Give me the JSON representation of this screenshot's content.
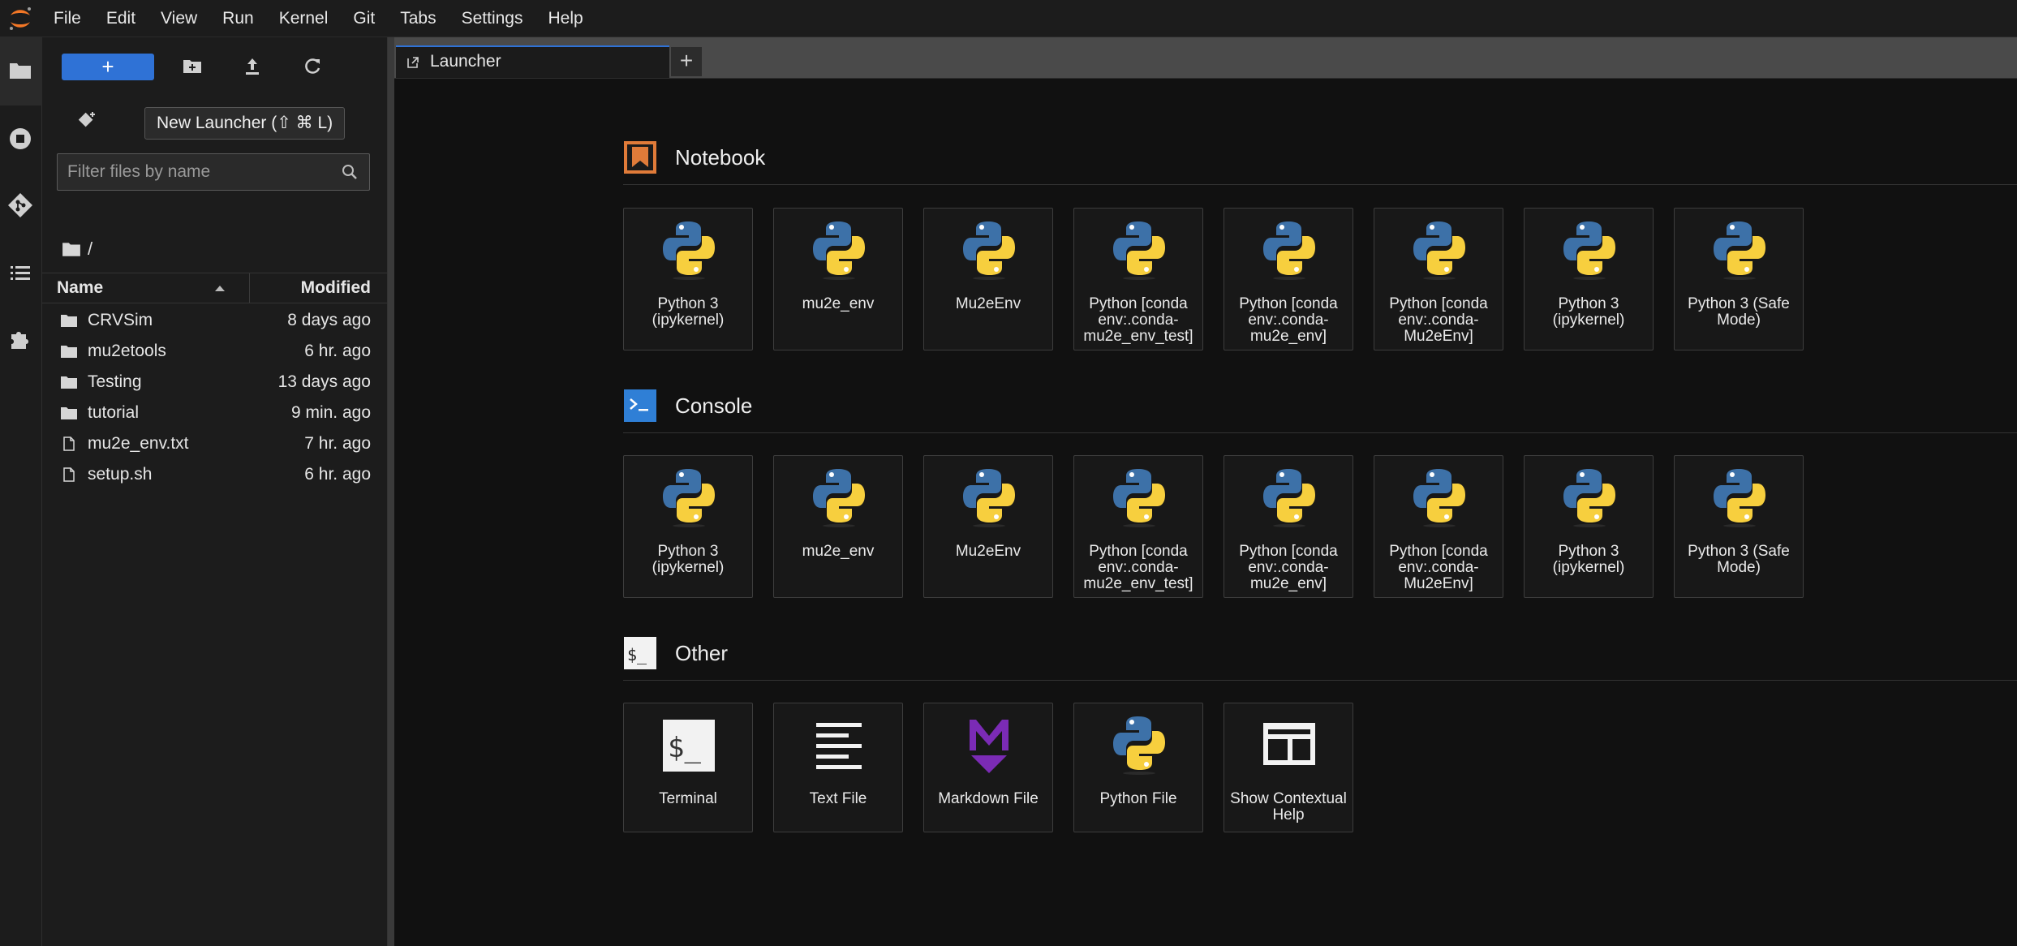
{
  "menubar": {
    "items": [
      "File",
      "Edit",
      "View",
      "Run",
      "Kernel",
      "Git",
      "Tabs",
      "Settings",
      "Help"
    ]
  },
  "filebrowser": {
    "new_launcher_label": "+",
    "tooltip": "New Launcher (⇧ ⌘ L)",
    "filter_placeholder": "Filter files by name",
    "breadcrumb": "/",
    "columns": {
      "name": "Name",
      "modified": "Modified"
    },
    "files": [
      {
        "name": "CRVSim",
        "modified": "8 days ago",
        "type": "folder"
      },
      {
        "name": "mu2etools",
        "modified": "6 hr. ago",
        "type": "folder"
      },
      {
        "name": "Testing",
        "modified": "13 days ago",
        "type": "folder"
      },
      {
        "name": "tutorial",
        "modified": "9 min. ago",
        "type": "folder"
      },
      {
        "name": "mu2e_env.txt",
        "modified": "7 hr. ago",
        "type": "file"
      },
      {
        "name": "setup.sh",
        "modified": "6 hr. ago",
        "type": "file"
      }
    ]
  },
  "tabs": {
    "launcher_label": "Launcher",
    "add_label": "+"
  },
  "launcher": {
    "notebook": {
      "title": "Notebook",
      "kernels": [
        "Python 3 (ipykernel)",
        "mu2e_env",
        "Mu2eEnv",
        "Python [conda env:.conda-mu2e_env_test]",
        "Python [conda env:.conda-mu2e_env]",
        "Python [conda env:.conda-Mu2eEnv]",
        "Python 3 (ipykernel)",
        "Python 3 (Safe Mode)"
      ]
    },
    "console": {
      "title": "Console",
      "kernels": [
        "Python 3 (ipykernel)",
        "mu2e_env",
        "Mu2eEnv",
        "Python [conda env:.conda-mu2e_env_test]",
        "Python [conda env:.conda-mu2e_env]",
        "Python [conda env:.conda-Mu2eEnv]",
        "Python 3 (ipykernel)",
        "Python 3 (Safe Mode)"
      ]
    },
    "other": {
      "title": "Other",
      "items": [
        {
          "label": "Terminal",
          "icon": "terminal-icon"
        },
        {
          "label": "Text File",
          "icon": "text-file-icon"
        },
        {
          "label": "Markdown File",
          "icon": "markdown-icon"
        },
        {
          "label": "Python File",
          "icon": "python-icon"
        },
        {
          "label": "Show Contextual Help",
          "icon": "contextual-help-icon"
        }
      ]
    }
  },
  "colors": {
    "accent": "#2f72d6",
    "notebook_icon": "#e07b39",
    "console_icon": "#2f7fd6",
    "markdown": "#7b2bb5",
    "python_blue": "#3d71a8",
    "python_yellow": "#f7cf3e"
  }
}
